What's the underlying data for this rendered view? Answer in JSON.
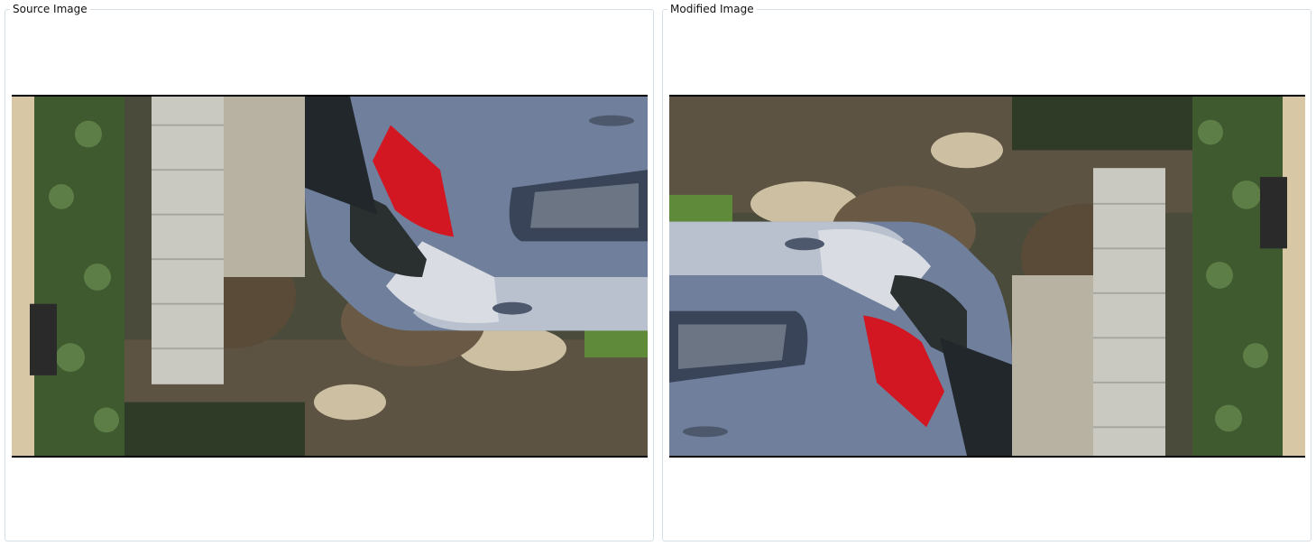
{
  "panels": {
    "source": {
      "title": "Source Image",
      "image_alt": "Photo of a grey hatchback car parked beside a garden path, shown upside down"
    },
    "modified": {
      "title": "Modified Image",
      "image_alt": "Same photo of the grey hatchback car beside a garden path, rotated upright"
    }
  },
  "colors": {
    "panel_border": "#d5dfe5",
    "car_body": "#6f7f9c",
    "tail_light": "#d31722",
    "foliage": "#3f5a2e",
    "path": "#c9c9c2"
  }
}
